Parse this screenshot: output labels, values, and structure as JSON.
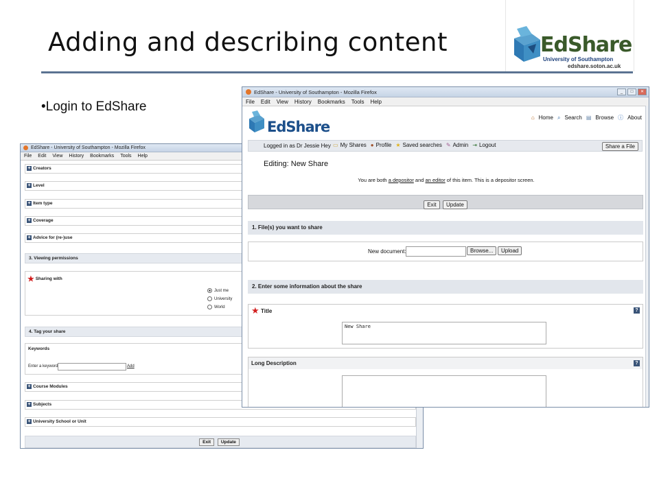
{
  "slide": {
    "title": "Adding and describing content",
    "bullet": "•Login to EdShare"
  },
  "logo": {
    "word": "EdShare",
    "line1": "University of Southampton",
    "line2": "edshare.soton.ac.uk"
  },
  "browser": {
    "title": "EdShare - University of Southampton - Mozilla Firefox",
    "menu": [
      "File",
      "Edit",
      "View",
      "History",
      "Bookmarks",
      "Tools",
      "Help"
    ]
  },
  "left_form": {
    "collapsed_sections": [
      "Creators",
      "Level",
      "Item type",
      "Coverage",
      "Advice for (re-)use"
    ],
    "section3": "3. Viewing permissions",
    "sharing_with": "Sharing with",
    "options": [
      "Just me",
      "University",
      "World"
    ],
    "selected_option": "Just me",
    "section4": "4. Tag your share",
    "keywords": "Keywords",
    "keyword_label": "Enter a keyword:",
    "keyword_add": "Add",
    "tag_sections": [
      "Course Modules",
      "Subjects",
      "University School or Unit"
    ],
    "exit": "Exit",
    "update": "Update"
  },
  "right_page": {
    "logo_word": "EdShare",
    "nav": [
      "Home",
      "Search",
      "Browse",
      "About"
    ],
    "logged_in": "Logged in as Dr Jessie Hey",
    "user_links": [
      "My Shares",
      "Profile",
      "Saved searches",
      "Admin",
      "Logout"
    ],
    "share_file": "Share a File",
    "heading": "Editing: New Share",
    "notice_prefix": "You are both",
    "notice_depositor": "a depositor",
    "notice_and": "and",
    "notice_editor": "an editor",
    "notice_suffix": "of this item. This is a depositor screen.",
    "exit": "Exit",
    "update": "Update",
    "section1": "1. File(s) you want to share",
    "new_document": "New document:",
    "browse": "Browse...",
    "upload": "Upload",
    "section2": "2. Enter some information about the share",
    "title_label": "Title",
    "title_value": "New Share",
    "long_description": "Long Description",
    "help": "?"
  },
  "colors": {
    "rule": "#5a7291",
    "section_gray": "#e2e6ec",
    "required_star": "#d21f1f"
  }
}
